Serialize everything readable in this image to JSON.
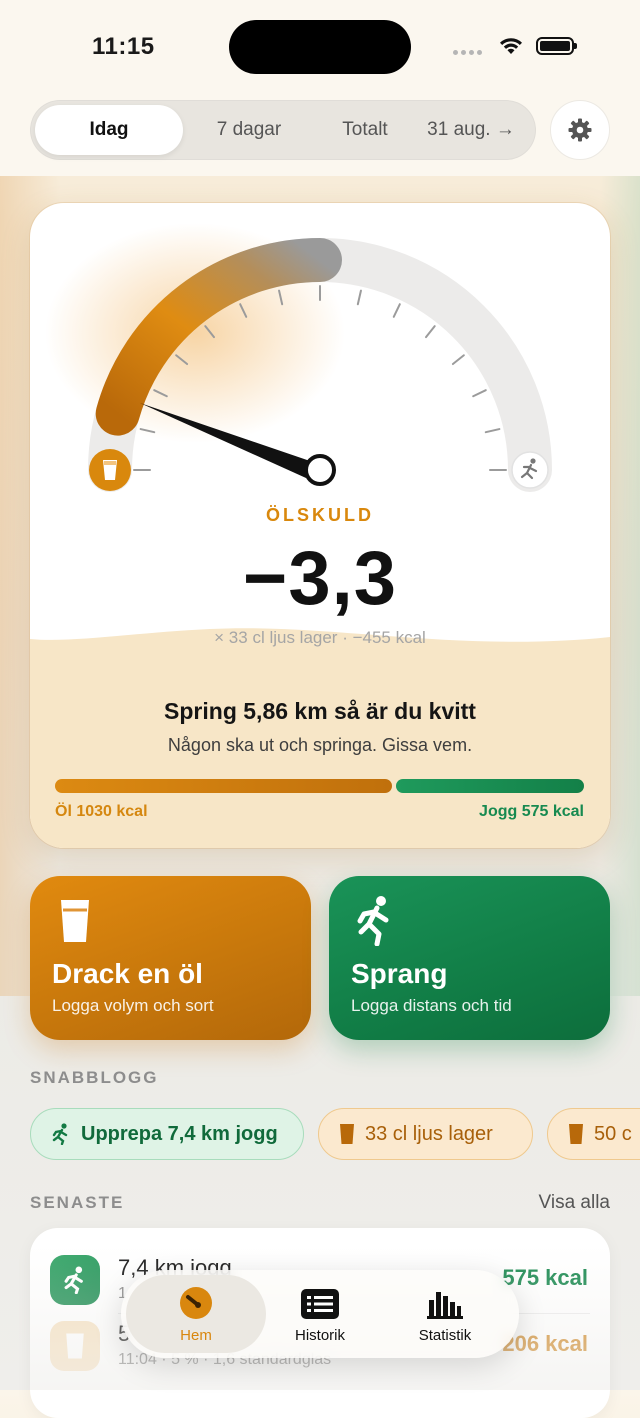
{
  "status_bar": {
    "time": "11:15"
  },
  "segments": [
    {
      "label": "Idag",
      "active": true
    },
    {
      "label": "7 dagar",
      "active": false
    },
    {
      "label": "Totalt",
      "active": false
    },
    {
      "label": "31 aug. →",
      "active": false
    }
  ],
  "gauge": {
    "label": "ÖLSKULD",
    "value": "−3,3",
    "subtitle": "× 33 cl ljus lager · −455 kcal",
    "payoff_title": "Spring 5,86 km så är du kvitt",
    "payoff_subtitle": "Någon ska ut och springa. Gissa vem.",
    "beer_bar_label": "Öl 1030 kcal",
    "jog_bar_label": "Jogg 575 kcal",
    "beer_kcal": 1030,
    "jog_kcal": 575,
    "colors": {
      "beer": "#d9880d",
      "jog": "#178a50"
    }
  },
  "actions": {
    "beer": {
      "title": "Drack en öl",
      "subtitle": "Logga volym och sort"
    },
    "run": {
      "title": "Sprang",
      "subtitle": "Logga distans och tid"
    }
  },
  "quicklog": {
    "heading": "SNABBLOGG",
    "chips": [
      {
        "label": "Upprepa 7,4 km jogg"
      },
      {
        "label": "33 cl ljus lager"
      },
      {
        "label": "50 c"
      }
    ]
  },
  "recent": {
    "heading": "SENASTE",
    "see_all": "Visa alla",
    "items": [
      {
        "title": "7,4 km jogg",
        "subtitle": "1",
        "kcal": "575 kcal"
      },
      {
        "title": "5",
        "subtitle": "11:04 · 5 % · 1,6 standardglas",
        "kcal": "206 kcal"
      }
    ]
  },
  "tabbar": [
    {
      "label": "Hem",
      "active": true
    },
    {
      "label": "Historik",
      "active": false
    },
    {
      "label": "Statistik",
      "active": false
    }
  ]
}
